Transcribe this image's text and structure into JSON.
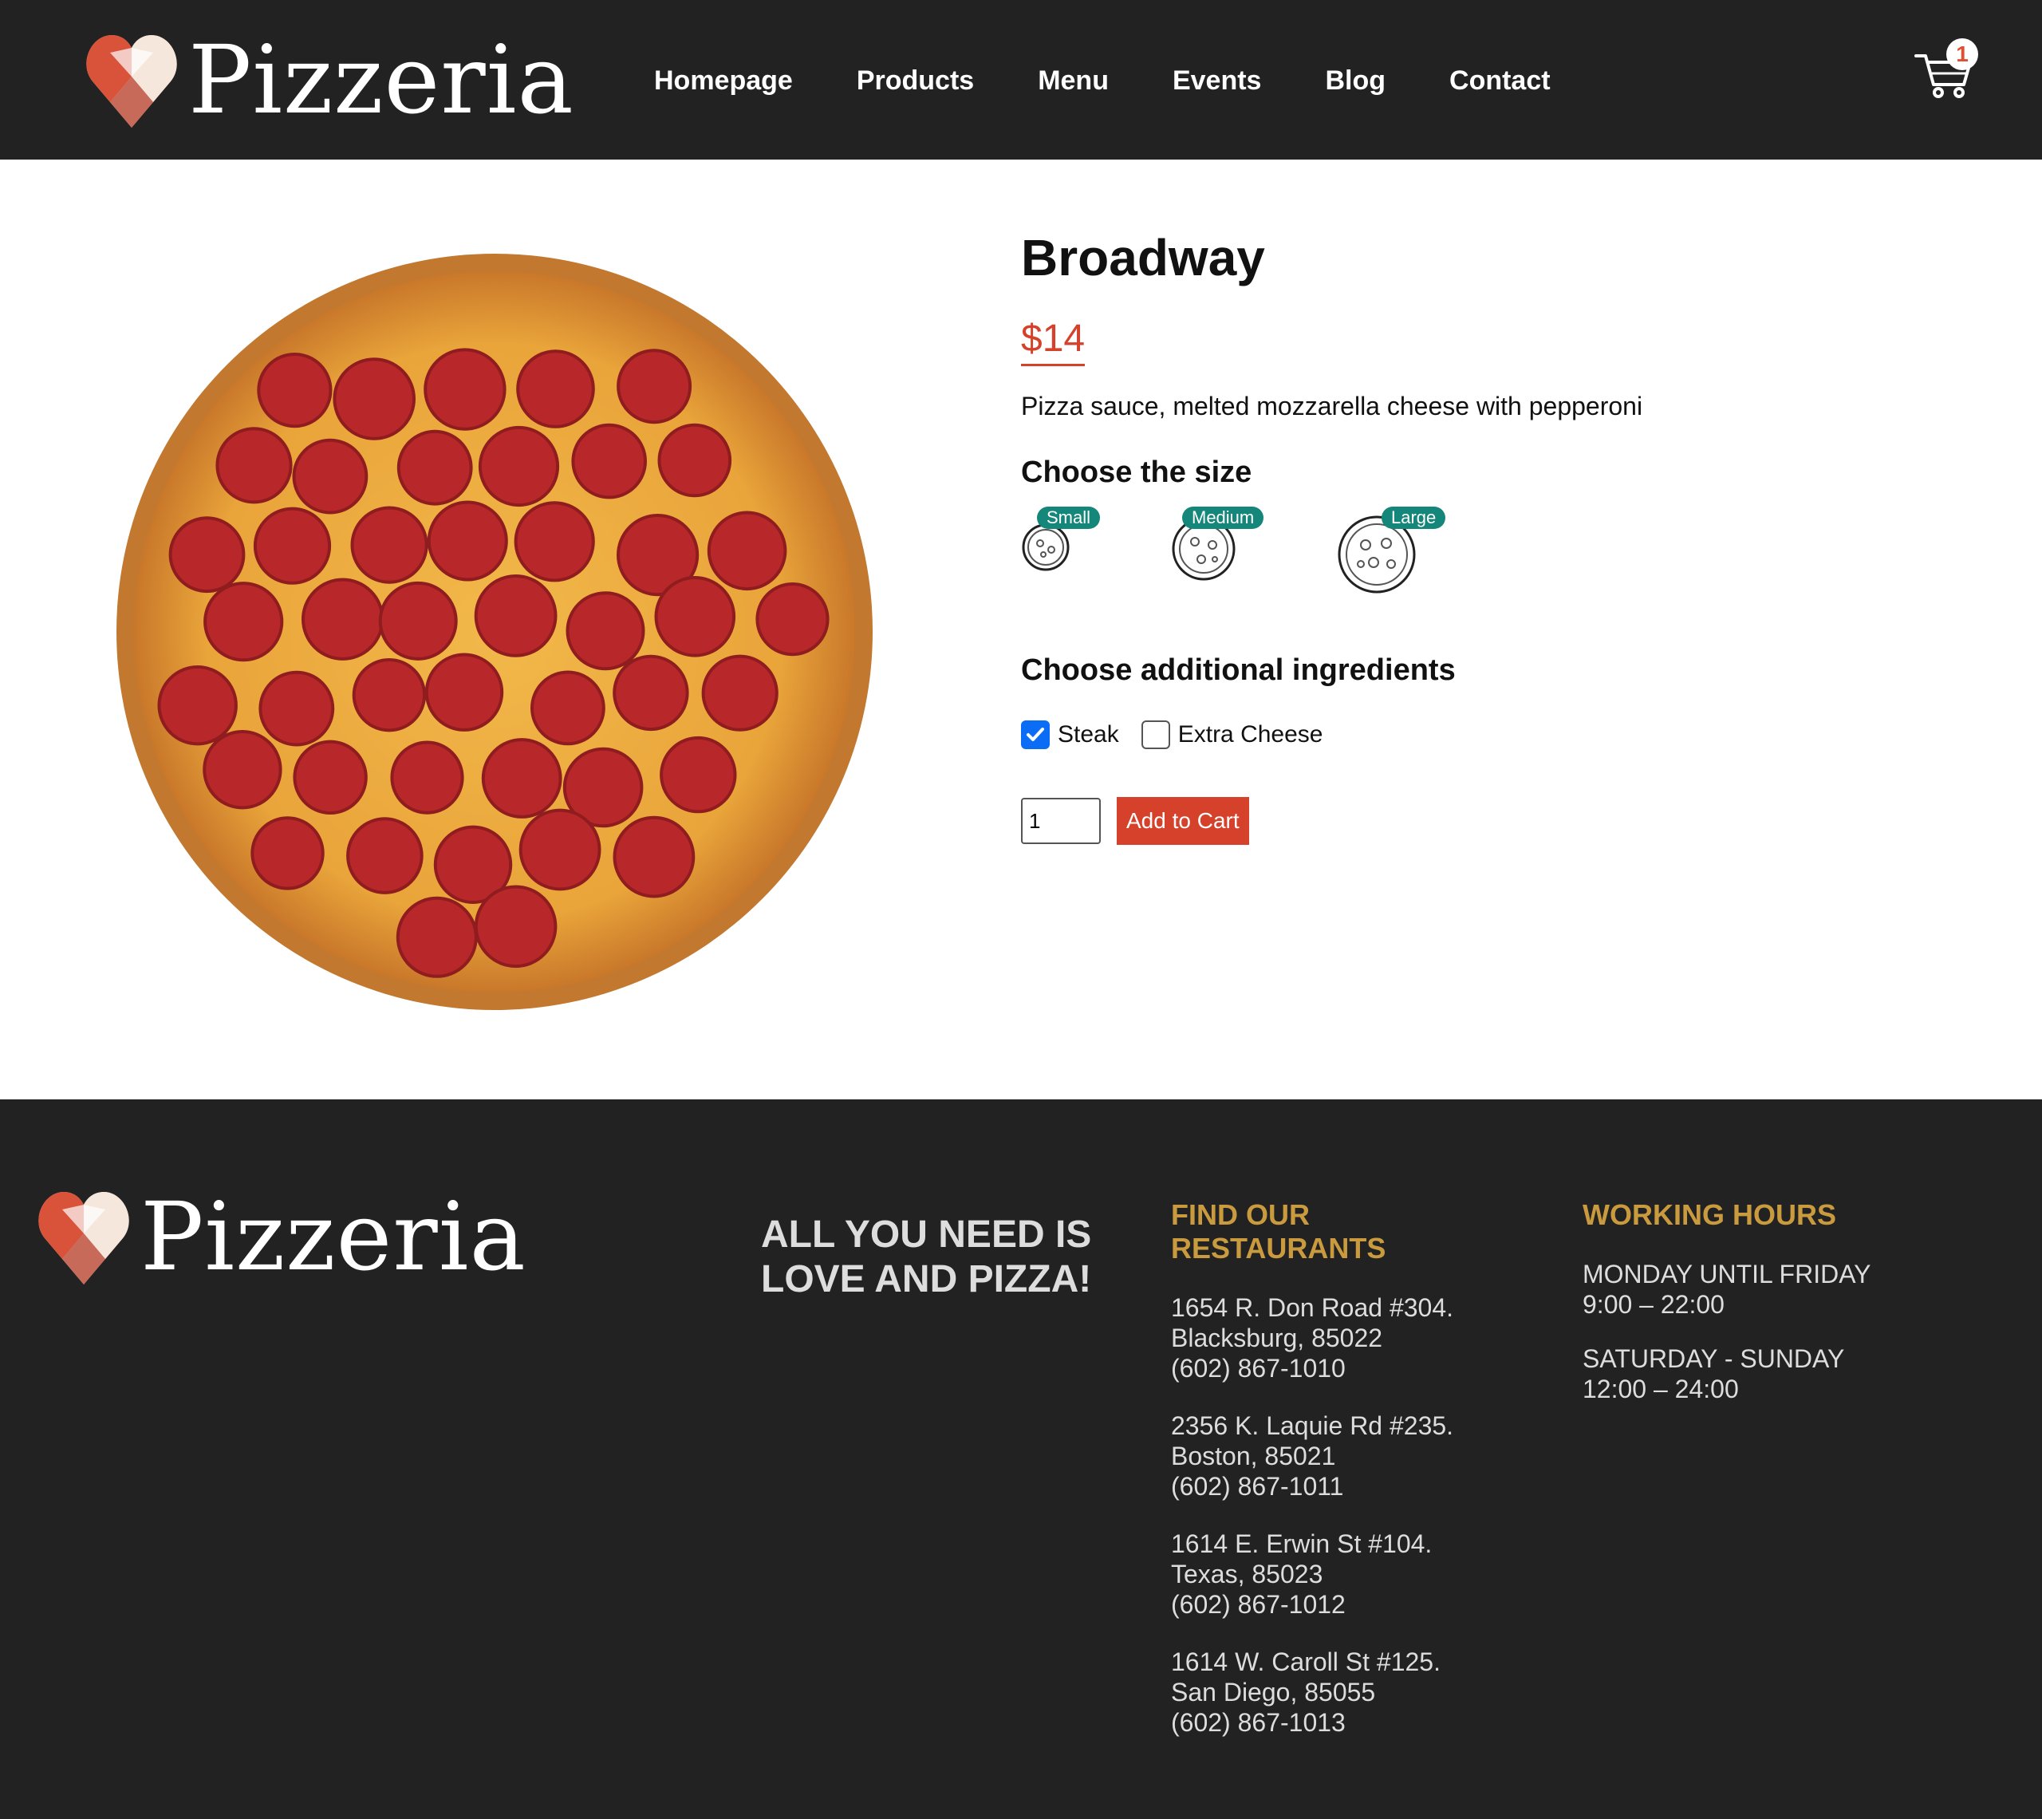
{
  "brand": {
    "name": "Pizzeria"
  },
  "nav": {
    "items": [
      "Homepage",
      "Products",
      "Menu",
      "Events",
      "Blog",
      "Contact"
    ]
  },
  "cart": {
    "count": "1"
  },
  "product": {
    "name": "Broadway",
    "price": "$14",
    "description": "Pizza sauce, melted mozzarella cheese with pepperoni",
    "size_heading": "Choose the size",
    "sizes": [
      "Small",
      "Medium",
      "Large"
    ],
    "ingredients_heading": "Choose additional ingredients",
    "ingredients": [
      {
        "label": "Steak",
        "checked": true
      },
      {
        "label": "Extra Cheese",
        "checked": false
      }
    ],
    "quantity": "1",
    "add_to_cart": "Add to Cart"
  },
  "footer": {
    "slogan": "ALL YOU NEED IS LOVE AND PIZZA!",
    "restaurants_heading": "FIND OUR RESTAURANTS",
    "restaurants": [
      {
        "street": "1654 R. Don Road #304.",
        "city": "Blacksburg, 85022",
        "phone": "(602) 867-1010"
      },
      {
        "street": "2356 K. Laquie Rd #235.",
        "city": "Boston, 85021",
        "phone": "(602) 867-1011"
      },
      {
        "street": "1614 E. Erwin St #104.",
        "city": "Texas, 85023",
        "phone": "(602) 867-1012"
      },
      {
        "street": "1614 W. Caroll St #125.",
        "city": "San Diego, 85055",
        "phone": "(602) 867-1013"
      }
    ],
    "hours_heading": "WORKING HOURS",
    "hours": [
      {
        "days": "MONDAY UNTIL FRIDAY",
        "time": "9:00 – 22:00"
      },
      {
        "days": "SATURDAY - SUNDAY",
        "time": "12:00 – 24:00"
      }
    ]
  },
  "colors": {
    "dark_bg": "#222222",
    "accent_red": "#d5412a",
    "gold": "#c99b3e",
    "teal_tag": "#14867a",
    "checkbox_blue": "#0b6cf6"
  }
}
